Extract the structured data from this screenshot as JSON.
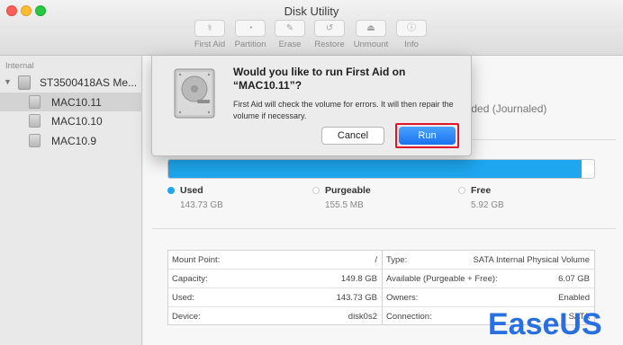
{
  "window": {
    "title": "Disk Utility"
  },
  "toolbar": {
    "items": [
      {
        "label": "First Aid",
        "icon": "first-aid-icon",
        "glyph": "⚕"
      },
      {
        "label": "Partition",
        "icon": "partition-icon",
        "glyph": "◔"
      },
      {
        "label": "Erase",
        "icon": "erase-icon",
        "glyph": "✎"
      },
      {
        "label": "Restore",
        "icon": "restore-icon",
        "glyph": "↺"
      },
      {
        "label": "Unmount",
        "icon": "unmount-icon",
        "glyph": "⏏"
      },
      {
        "label": "Info",
        "icon": "info-icon",
        "glyph": "ⓘ"
      }
    ]
  },
  "sidebar": {
    "section": "Internal",
    "disk": "ST3500418AS Me...",
    "volumes": [
      {
        "name": "MAC10.11",
        "selected": true
      },
      {
        "name": "MAC10.10",
        "selected": false
      },
      {
        "name": "MAC10.9",
        "selected": false
      }
    ]
  },
  "main": {
    "format_partial": "ended (Journaled)",
    "usage": {
      "used_fraction": 0.97,
      "used_color": "#1ea6ee",
      "legend": [
        {
          "name": "Used",
          "size": "143.73 GB",
          "color": "#1ea6ee"
        },
        {
          "name": "Purgeable",
          "size": "155.5 MB",
          "color": "#ffffff"
        },
        {
          "name": "Free",
          "size": "5.92 GB",
          "color": "#ffffff"
        }
      ]
    },
    "info_left": [
      {
        "key": "Mount Point:",
        "value": "/"
      },
      {
        "key": "Capacity:",
        "value": "149.8 GB"
      },
      {
        "key": "Used:",
        "value": "143.73 GB"
      },
      {
        "key": "Device:",
        "value": "disk0s2"
      }
    ],
    "info_right": [
      {
        "key": "Type:",
        "value": "SATA Internal Physical Volume"
      },
      {
        "key": "Available (Purgeable + Free):",
        "value": "6.07 GB"
      },
      {
        "key": "Owners:",
        "value": "Enabled"
      },
      {
        "key": "Connection:",
        "value": "SATA"
      }
    ]
  },
  "dialog": {
    "title": "Would you like to run First Aid on “MAC10.11”?",
    "message": "First Aid will check the volume for errors. It will then repair the volume if necessary.",
    "cancel_label": "Cancel",
    "run_label": "Run",
    "highlight_color": "#e0142a"
  },
  "watermark": {
    "text": "EaseUS"
  }
}
